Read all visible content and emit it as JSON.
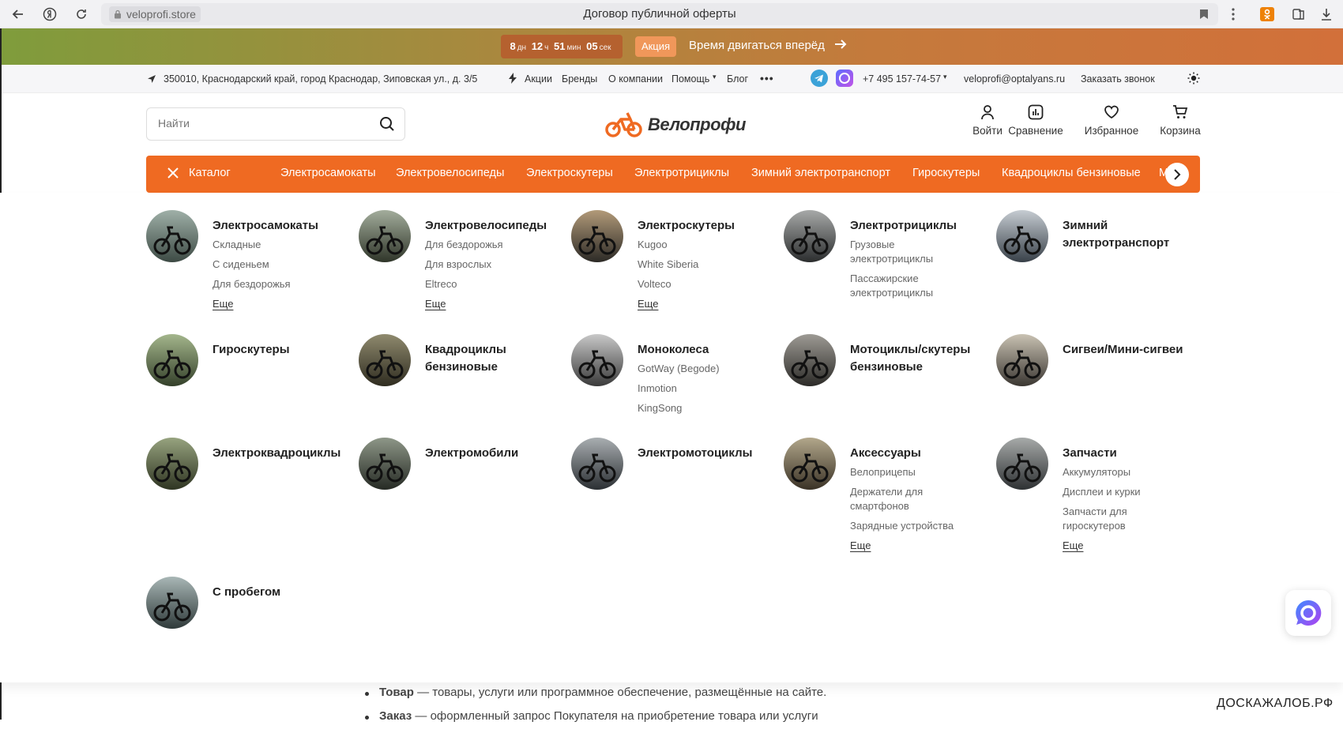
{
  "browser": {
    "url": "veloprofi.store",
    "page_title": "Договор публичной оферты"
  },
  "promo": {
    "days": "8",
    "days_unit": "дн",
    "hours": "12",
    "hours_unit": "ч",
    "minutes": "51",
    "minutes_unit": "мин",
    "seconds": "05",
    "seconds_unit": "сек",
    "badge": "Акция",
    "text": "Время двигаться вперёд",
    "colors": {
      "start": "#7f9c3c",
      "end": "#d2703a"
    }
  },
  "infobar": {
    "address": "350010, Краснодарский край, город Краснодар, Зиповская ул., д. 3/5",
    "links": [
      "Акции",
      "Бренды",
      "О компании",
      "Помощь",
      "Блог"
    ],
    "phone": "+7 495 157-74-57",
    "email": "veloprofi@optalyans.ru",
    "callback": "Заказать звонок"
  },
  "header": {
    "search_placeholder": "Найти",
    "logo_text": "Велопрофи",
    "actions": {
      "login": "Войти",
      "compare": "Сравнение",
      "favorites": "Избранное",
      "cart": "Корзина"
    }
  },
  "catalog_nav": {
    "catalog_label": "Каталог",
    "items": [
      "Электросамокаты",
      "Электровелосипеды",
      "Электроскутеры",
      "Электротрициклы",
      "Зимний электротранспорт",
      "Гироскутеры",
      "Квадроциклы бензиновые",
      "М"
    ],
    "accent": "#ef6a22"
  },
  "categories": [
    {
      "title": "Электросамокаты",
      "subs": [
        "Складные",
        "С сиденьем",
        "Для бездорожья"
      ],
      "more": "Еще"
    },
    {
      "title": "Электровелосипеды",
      "subs": [
        "Для бездорожья",
        "Для взрослых",
        "Eltreco"
      ],
      "more": "Еще"
    },
    {
      "title": "Электроскутеры",
      "subs": [
        "Kugoo",
        "White Siberia",
        "Volteco"
      ],
      "more": "Еще"
    },
    {
      "title": "Электротрициклы",
      "subs": [
        "Грузовые электротрициклы",
        "Пассажирские электротрициклы"
      ],
      "more": ""
    },
    {
      "title": "Зимний электротранспорт",
      "subs": [],
      "more": ""
    },
    {
      "title": "Гироскутеры",
      "subs": [],
      "more": ""
    },
    {
      "title": "Квадроциклы бензиновые",
      "subs": [],
      "more": ""
    },
    {
      "title": "Моноколеса",
      "subs": [
        "GotWay (Begode)",
        "Inmotion",
        "KingSong"
      ],
      "more": ""
    },
    {
      "title": "Мотоциклы/скутеры бензиновые",
      "subs": [],
      "more": ""
    },
    {
      "title": "Сигвеи/Мини-сигвеи",
      "subs": [],
      "more": ""
    },
    {
      "title": "Электроквадроциклы",
      "subs": [],
      "more": ""
    },
    {
      "title": "Электромобили",
      "subs": [],
      "more": ""
    },
    {
      "title": "Электромотоциклы",
      "subs": [],
      "more": ""
    },
    {
      "title": "Аксессуары",
      "subs": [
        "Велоприцепы",
        "Держатели для смартфонов",
        "Зарядные устройства"
      ],
      "more": "Еще"
    },
    {
      "title": "Запчасти",
      "subs": [
        "Аккумуляторы",
        "Дисплеи и курки",
        "Запчасти для гироскутеров"
      ],
      "more": "Еще"
    },
    {
      "title": "С пробегом",
      "subs": [],
      "more": ""
    }
  ],
  "document": {
    "items": [
      {
        "term": "Товар",
        "text": " — товары, услуги или программное обеспечение, размещённые на сайте."
      },
      {
        "term": "Заказ",
        "text": " — оформленный запрос Покупателя на приобретение товара или услуги"
      }
    ]
  },
  "watermark": "ДОСКАЖАЛОБ.РФ"
}
